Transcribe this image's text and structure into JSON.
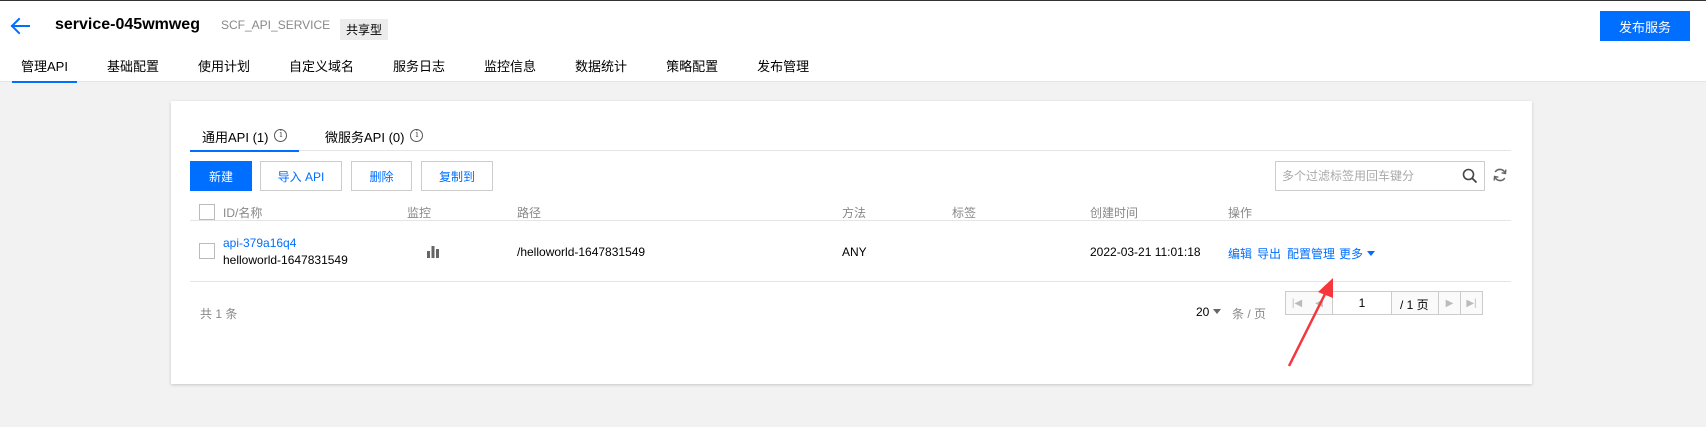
{
  "header": {
    "service_name": "service-045wmweg",
    "service_type": "SCF_API_SERVICE",
    "badge": "共享型",
    "publish_label": "发布服务"
  },
  "tabs": [
    {
      "label": "管理API",
      "active": true
    },
    {
      "label": "基础配置"
    },
    {
      "label": "使用计划"
    },
    {
      "label": "自定义域名"
    },
    {
      "label": "服务日志"
    },
    {
      "label": "监控信息"
    },
    {
      "label": "数据统计"
    },
    {
      "label": "策略配置"
    },
    {
      "label": "发布管理"
    }
  ],
  "subtabs": {
    "general": "通用API (1)",
    "micro": "微服务API (0)"
  },
  "toolbar": {
    "new_label": "新建",
    "import_label": "导入 API",
    "delete_label": "删除",
    "copy_label": "复制到",
    "search_placeholder": "多个过滤标签用回车键分"
  },
  "table": {
    "headers": {
      "id_name": "ID/名称",
      "monitor": "监控",
      "path": "路径",
      "method": "方法",
      "tags": "标签",
      "created": "创建时间",
      "actions": "操作"
    },
    "rows": [
      {
        "id": "api-379a16q4",
        "name": "helloworld-1647831549",
        "path": "/helloworld-1647831549",
        "method": "ANY",
        "tags": "",
        "created": "2022-03-21 11:01:18",
        "actions": {
          "edit": "编辑",
          "export": "导出",
          "config": "配置管理",
          "more": "更多"
        }
      }
    ]
  },
  "footer": {
    "total": "共 1 条",
    "page_size": "20",
    "per_page": "条 / 页",
    "current_page": "1",
    "total_pages": "/ 1 页"
  },
  "colors": {
    "accent": "#006eff",
    "annotation_arrow": "#f5363c"
  }
}
